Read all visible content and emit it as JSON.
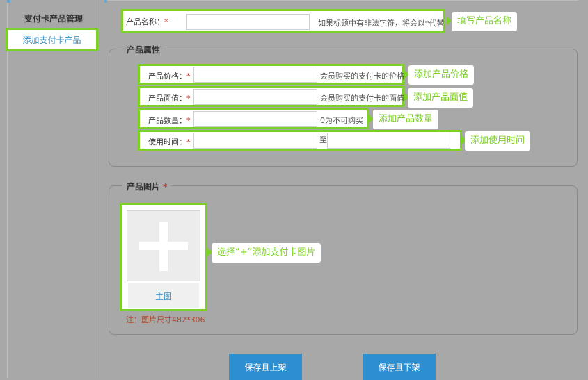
{
  "sidebar": {
    "title": "支付卡产品管理",
    "active_item": "添加支付卡产品"
  },
  "product_name": {
    "label": "产品名称：",
    "required_mark": "*",
    "value": "",
    "hint": "如果标题中有非法字符，将会以*代替",
    "callout": "填写产品名称"
  },
  "attributes": {
    "legend": "产品属性",
    "price": {
      "label": "产品价格：",
      "required_mark": "*",
      "value": "",
      "hint": "会员购买的支付卡的价格",
      "callout": "添加产品价格"
    },
    "face_value": {
      "label": "产品面值：",
      "required_mark": "*",
      "value": "",
      "hint": "会员购买的支付卡的面值",
      "callout": "添加产品面值"
    },
    "quantity": {
      "label": "产品数量：",
      "required_mark": "*",
      "value": "",
      "hint": "0为不可购买",
      "callout": "添加产品数量"
    },
    "use_time": {
      "label": "使用时间：",
      "required_mark": "*",
      "start_value": "",
      "separator": "至",
      "end_value": "",
      "callout": "添加使用时间"
    }
  },
  "image": {
    "legend": "产品图片",
    "required_mark": "*",
    "main_caption": "主图",
    "note": "注：图片尺寸482*306",
    "callout": "选择“+”添加支付卡图片"
  },
  "actions": {
    "save_publish": "保存且上架",
    "save_unpublish": "保存且下架"
  },
  "colors": {
    "highlight": "#7cd026",
    "button": "#2e8fd0",
    "link": "#3a93c9",
    "overlay": "#a8a8a8"
  }
}
